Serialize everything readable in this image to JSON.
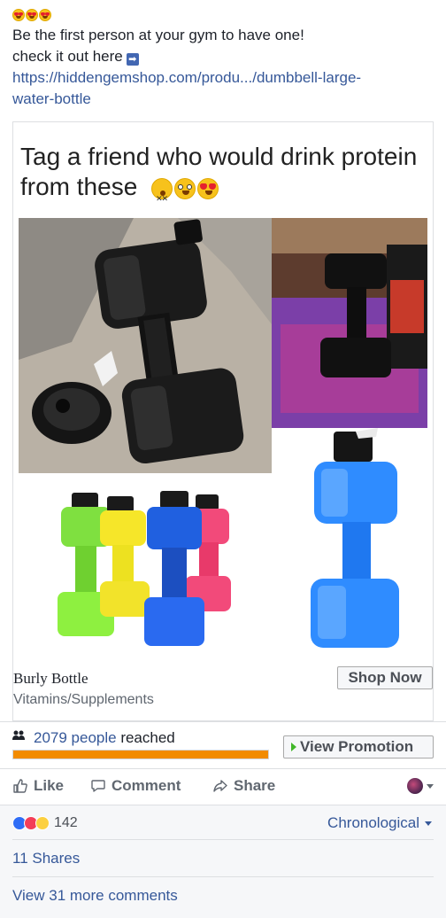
{
  "post": {
    "emojis": [
      "heart-eyes",
      "heart-eyes",
      "heart-eyes"
    ],
    "line1": "Be the first person at your gym to have one!",
    "line2": "check it out here",
    "link_line1": "https://hiddengemshop.com/produ.../dumbbell-large-",
    "link_line2": "water-bottle"
  },
  "card": {
    "caption": "Tag a friend who would drink protein from these",
    "caption_emojis": [
      "dizzy-face-emoji",
      "flushed-face-emoji",
      "heart-eyes-emoji"
    ],
    "title": "Burly Bottle",
    "subtitle": "Vitamins/Supplements",
    "cta": "Shop Now"
  },
  "reach": {
    "count": "2079 people",
    "suffix": " reached",
    "progress": 1.0,
    "promo_label": "View Promotion",
    "colors": {
      "bar": "#f28b00",
      "promo_triangle": "#42b72a"
    }
  },
  "actions": {
    "like": "Like",
    "comment": "Comment",
    "share": "Share"
  },
  "feedback": {
    "reaction_types": [
      "like",
      "love",
      "haha"
    ],
    "reaction_count": "142",
    "sort": "Chronological",
    "shares": "11 Shares",
    "more_comments": "View 31 more comments"
  }
}
